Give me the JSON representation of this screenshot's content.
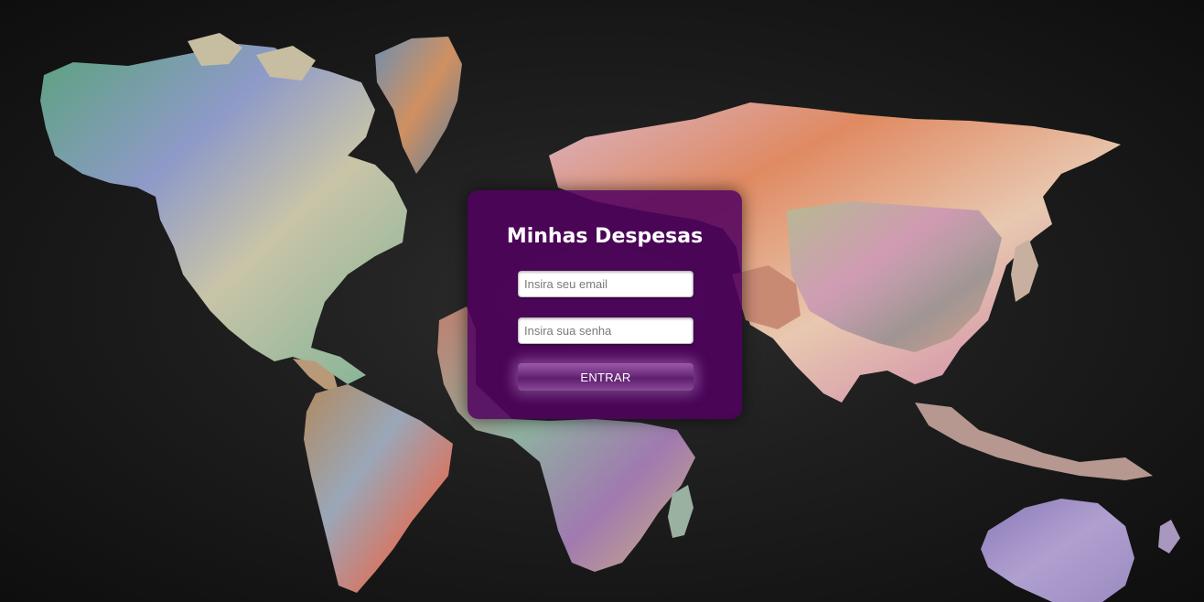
{
  "login": {
    "title": "Minhas Despesas",
    "email_placeholder": "Insira seu email",
    "email_value": "",
    "password_placeholder": "Insira sua senha",
    "password_value": "",
    "submit_label": "ENTRAR"
  },
  "colors": {
    "background": "#1f1f1f",
    "card": "#50005f",
    "button": "#6c2a7c",
    "title_text": "#ffffff"
  }
}
